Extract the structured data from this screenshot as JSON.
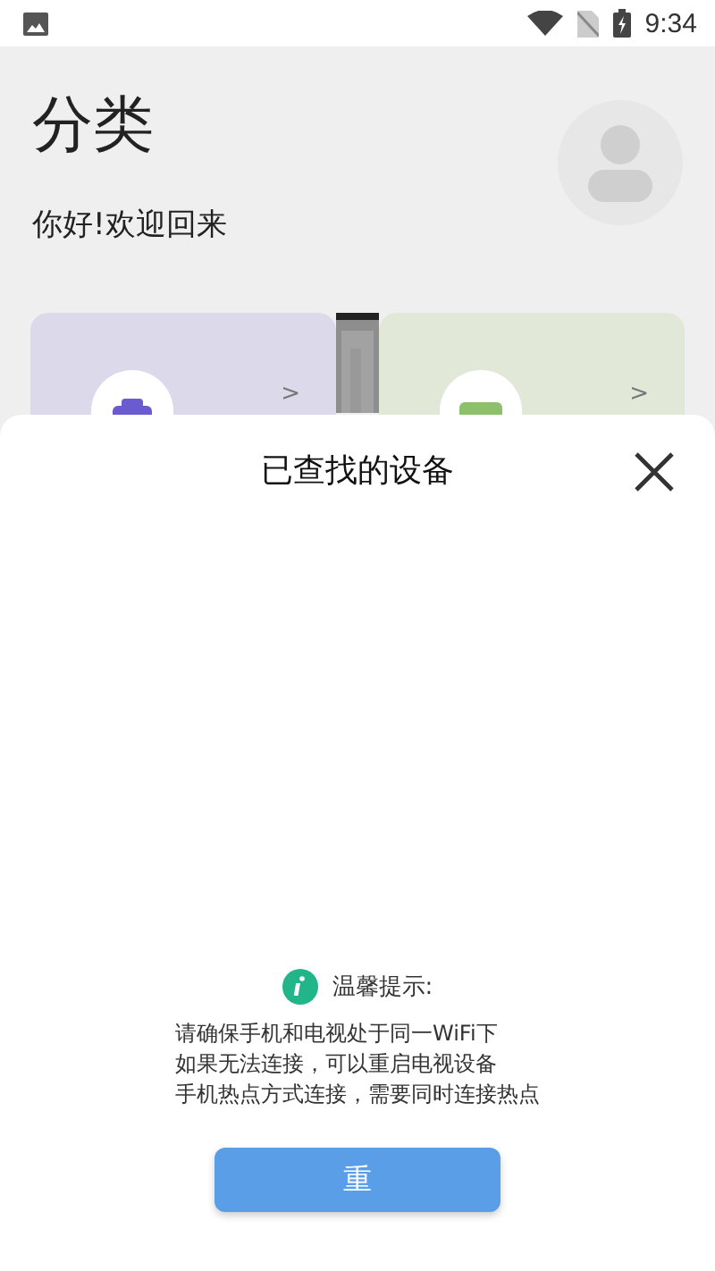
{
  "status_bar": {
    "time": "9:34"
  },
  "header": {
    "title": "分类",
    "greeting": "你好!欢迎回来"
  },
  "cards": [
    {
      "chevron": ">",
      "color": "#dcdaea",
      "kind": "purple"
    },
    {
      "chevron": ">",
      "color": "#e2e8d7",
      "kind": "green"
    }
  ],
  "sheet": {
    "title": "已查找的设备",
    "tip_title": "温馨提示:",
    "tip_lines": [
      "请确保手机和电视处于同一WiFi下",
      "如果无法连接，可以重启电视设备",
      "手机热点方式连接，需要同时连接热点"
    ],
    "button": "重"
  }
}
